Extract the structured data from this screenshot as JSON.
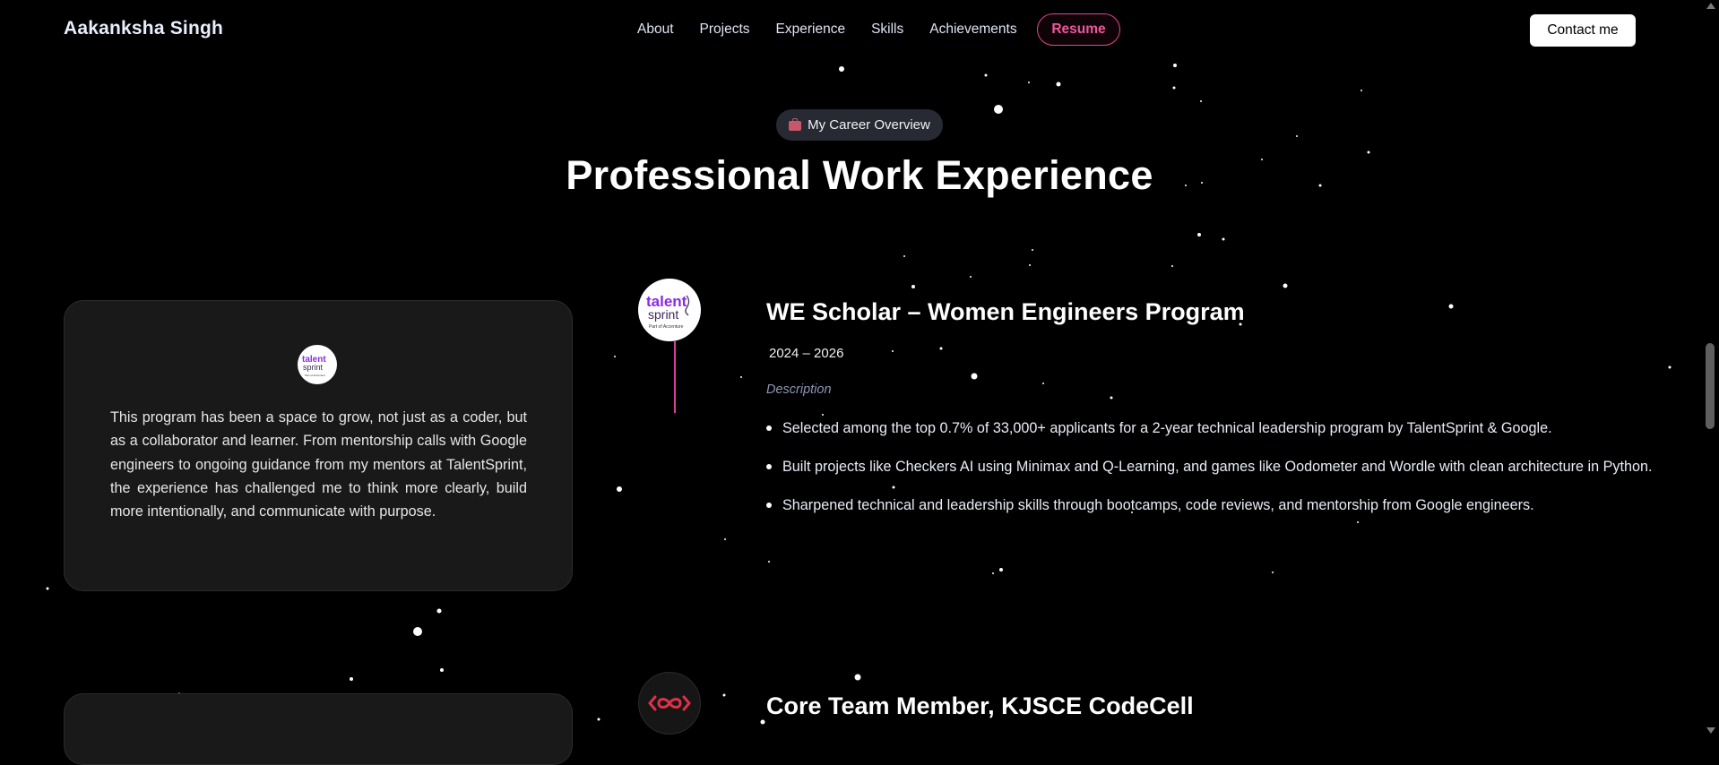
{
  "nav": {
    "brand": "Aakanksha Singh",
    "links": [
      "About",
      "Projects",
      "Experience",
      "Skills",
      "Achievements"
    ],
    "resume_label": "Resume",
    "contact_label": "Contact me"
  },
  "section": {
    "pill_label": "My Career Overview",
    "pill_icon": "briefcase-icon",
    "title": "Professional Work Experience"
  },
  "experiences": [
    {
      "logo_text": "talent sprint",
      "logo_sub": "Part of Accenture",
      "title": "WE Scholar – Women Engineers Program",
      "period": "2024 – 2026",
      "description_label": "Description",
      "bullets": [
        "Selected among the top 0.7% of 33,000+ applicants for a 2-year technical leadership program by TalentSprint & Google.",
        "Built projects like Checkers AI using Minimax and Q-Learning, and games like Oodometer and Wordle with clean architecture in Python.",
        "Sharpened technical and leadership skills through bootcamps, code reviews, and mentorship from Google engineers."
      ],
      "card_text": "This program has been a space to grow, not just as a coder, but as a collaborator and learner. From mentorship calls with Google engineers to ongoing guidance from my mentors at TalentSprint, the experience has challenged me to think more clearly, build more intentionally, and communicate with purpose."
    },
    {
      "title": "Core Team Member, KJSCE CodeCell"
    }
  ],
  "colors": {
    "accent": "#e0468f",
    "background": "#000000",
    "card": "#191919",
    "muted_label": "#8e95b3"
  }
}
